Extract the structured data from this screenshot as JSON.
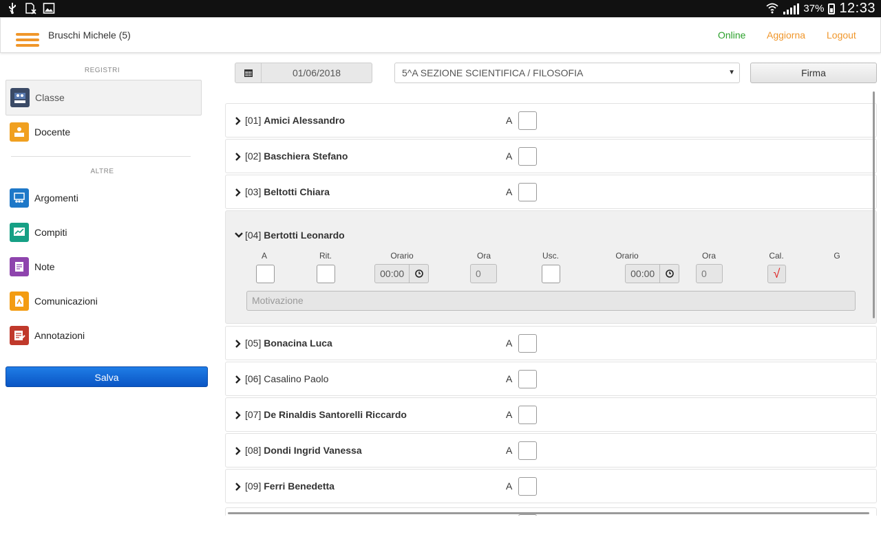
{
  "status_bar": {
    "battery": "37%",
    "time": "12:33"
  },
  "header": {
    "user": "Bruschi Michele (5)",
    "online": "Online",
    "aggiorna": "Aggiorna",
    "logout": "Logout",
    "colors": {
      "online": "#2aa02a",
      "links": "#f0962a",
      "menu": "#f0962a"
    }
  },
  "sidebar": {
    "section1": "REGISTRI",
    "section2": "ALTRE",
    "items": [
      {
        "label": "Classe",
        "icon": "class-icon",
        "color": "#3a4a66"
      },
      {
        "label": "Docente",
        "icon": "teacher-desk-icon",
        "color": "#f0a020"
      },
      {
        "label": "Argomenti",
        "icon": "topics-icon",
        "color": "#1e78c8"
      },
      {
        "label": "Compiti",
        "icon": "homework-icon",
        "color": "#16a085"
      },
      {
        "label": "Note",
        "icon": "note-icon",
        "color": "#8e44ad"
      },
      {
        "label": "Comunicazioni",
        "icon": "communication-icon",
        "color": "#f39c12"
      },
      {
        "label": "Annotazioni",
        "icon": "annotation-icon",
        "color": "#c0392b"
      }
    ],
    "save": "Salva"
  },
  "toolbar": {
    "date": "01/06/2018",
    "class": "5^A SEZIONE SCIENTIFICA / FILOSOFIA",
    "sign": "Firma"
  },
  "students": [
    {
      "num": "[01]",
      "name": "Amici Alessandro",
      "bold": true,
      "absent_label": "A"
    },
    {
      "num": "[02]",
      "name": "Baschiera Stefano",
      "bold": true,
      "absent_label": "A"
    },
    {
      "num": "[03]",
      "name": "Beltotti Chiara",
      "bold": true,
      "absent_label": "A"
    },
    {
      "num": "[04]",
      "name": "Bertotti Leonardo",
      "bold": true,
      "expanded": true
    },
    {
      "num": "[05]",
      "name": "Bonacina Luca",
      "bold": true,
      "absent_label": "A"
    },
    {
      "num": "[06]",
      "name": "Casalino Paolo",
      "bold": false,
      "absent_label": "A"
    },
    {
      "num": "[07]",
      "name": "De Rinaldis Santorelli Riccardo",
      "bold": true,
      "absent_label": "A"
    },
    {
      "num": "[08]",
      "name": "Dondi Ingrid Vanessa",
      "bold": true,
      "absent_label": "A"
    },
    {
      "num": "[09]",
      "name": "Ferri Benedetta",
      "bold": true,
      "absent_label": "A"
    }
  ],
  "detail": {
    "headers": {
      "a": "A",
      "rit": "Rit.",
      "orario1": "Orario",
      "ora1": "Ora",
      "usc": "Usc.",
      "orario2": "Orario",
      "ora2": "Ora",
      "cal": "Cal.",
      "g": "G"
    },
    "orario_entrata": "00:00",
    "ora_entrata": "0",
    "orario_uscita": "00:00",
    "ora_uscita": "0",
    "cal_mark": "√",
    "motivazione_placeholder": "Motivazione"
  }
}
